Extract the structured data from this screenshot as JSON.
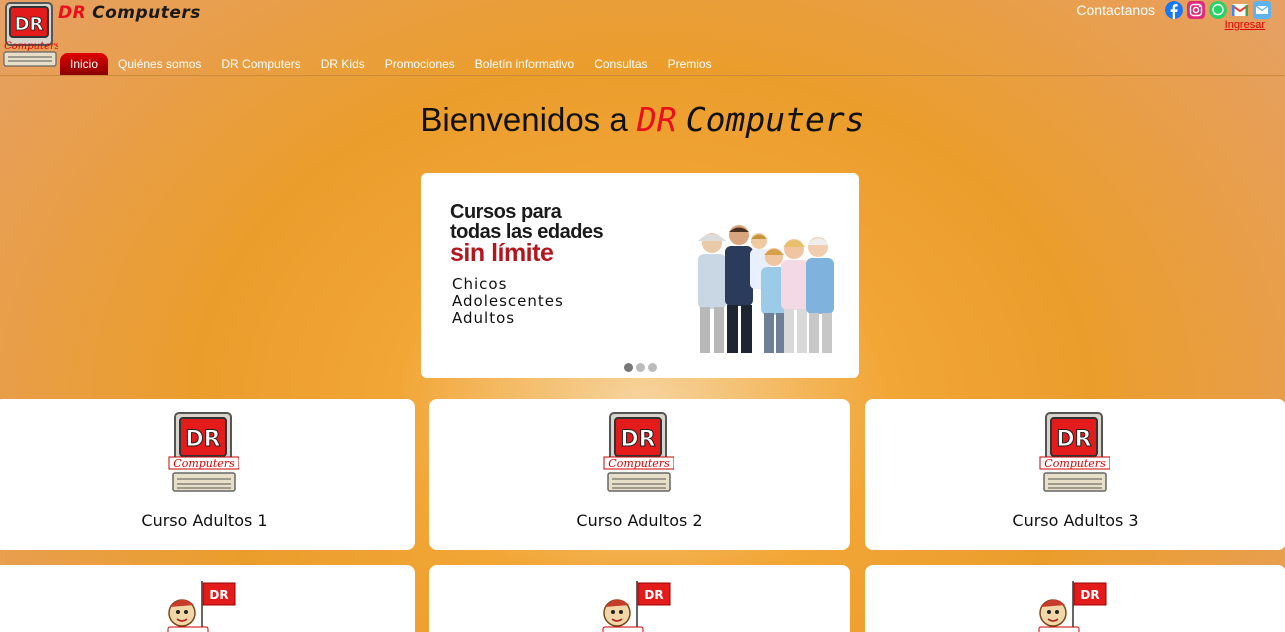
{
  "brand": {
    "dr": "DR",
    "rest": "Computers"
  },
  "nav": [
    {
      "label": "Inicio",
      "active": true
    },
    {
      "label": "Quiénes somos"
    },
    {
      "label": "DR Computers"
    },
    {
      "label": "DR Kids"
    },
    {
      "label": "Promociones"
    },
    {
      "label": "Boletín informativo"
    },
    {
      "label": "Consultas"
    },
    {
      "label": "Premios"
    }
  ],
  "contact": {
    "label": "Contactanos",
    "icons": [
      "facebook-icon",
      "instagram-icon",
      "whatsapp-icon",
      "gmail-icon",
      "email-icon"
    ],
    "login": "Ingresar"
  },
  "welcome": {
    "prefix": "Bienvenidos a",
    "dr": "DR",
    "rest": "Computers"
  },
  "carousel": {
    "line1": "Cursos para",
    "line2": "todas las edades",
    "highlight": "sin límite",
    "list": [
      "Chicos",
      "Adolescentes",
      "Adultos"
    ],
    "active_slide": 1,
    "slide_count": 3
  },
  "courses": [
    {
      "title": "Curso Adultos 1"
    },
    {
      "title": "Curso Adultos 2"
    },
    {
      "title": "Curso Adultos 3"
    }
  ],
  "kids_courses": [
    {
      "logo": "dr-kids-logo"
    },
    {
      "logo": "dr-kids-logo"
    },
    {
      "logo": "dr-kids-logo"
    }
  ],
  "colors": {
    "accent_red": "#e8101a",
    "nav_active": "#c00000",
    "background": "#f2a636"
  }
}
